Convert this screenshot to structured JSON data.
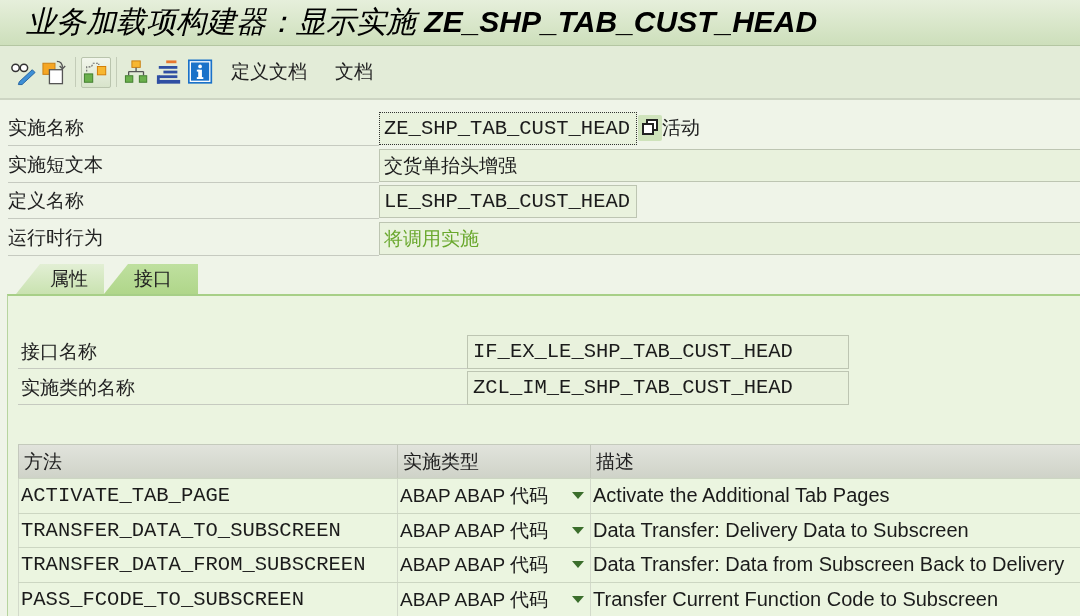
{
  "window": {
    "title": "业务加载项构建器：显示实施 **ZE_SHP_TAB_CUST_HEAD**"
  },
  "toolbar": {
    "icon_groups": [
      [
        {
          "pressed": false
        },
        {
          "pressed": false
        }
      ],
      [
        {
          "pressed": true
        }
      ],
      [
        {
          "pressed": false
        },
        {
          "pressed": false
        },
        {
          "pressed": false
        }
      ]
    ],
    "buttons": [
      "定义文档",
      "文档"
    ]
  },
  "fields": [
    {
      "kind": "short",
      "label": "实施名称",
      "value": "ZE_SHP_TAB_CUST_HEAD",
      "focused": true,
      "status": "活动"
    },
    {
      "kind": "long",
      "label": "实施短文本",
      "value": "交货单抬头增强",
      "focused": false
    },
    {
      "kind": "short",
      "label": "定义名称",
      "value": "LE_SHP_TAB_CUST_HEAD",
      "focused": false
    },
    {
      "kind": "message",
      "label": "运行时行为",
      "value": "将调用实施",
      "focused": false
    }
  ],
  "tabs": [
    {
      "label": "属性",
      "selected": false
    },
    {
      "label": "接口",
      "selected": true
    }
  ],
  "interface": {
    "fields": [
      {
        "label": "接口名称",
        "value": "IF_EX_LE_SHP_TAB_CUST_HEAD"
      },
      {
        "label": "实施类的名称",
        "value": "ZCL_IM_E_SHP_TAB_CUST_HEAD"
      }
    ],
    "table": {
      "columns": [
        "方法",
        "实施类型",
        "描述"
      ],
      "rows": [
        {
          "method": "ACTIVATE_TAB_PAGE",
          "type": "ABAP ABAP 代码",
          "description": "Activate the Additional Tab Pages"
        },
        {
          "method": "TRANSFER_DATA_TO_SUBSCREEN",
          "type": "ABAP ABAP 代码",
          "description": "Data Transfer: Delivery Data to Subscreen"
        },
        {
          "method": "TRANSFER_DATA_FROM_SUBSCREEN",
          "type": "ABAP ABAP 代码",
          "description": "Data Transfer: Data from Subscreen Back to Delivery"
        },
        {
          "method": "PASS_FCODE_TO_SUBSCREEN",
          "type": "ABAP ABAP 代码",
          "description": "Transfer Current Function Code to Subscreen"
        }
      ]
    }
  }
}
